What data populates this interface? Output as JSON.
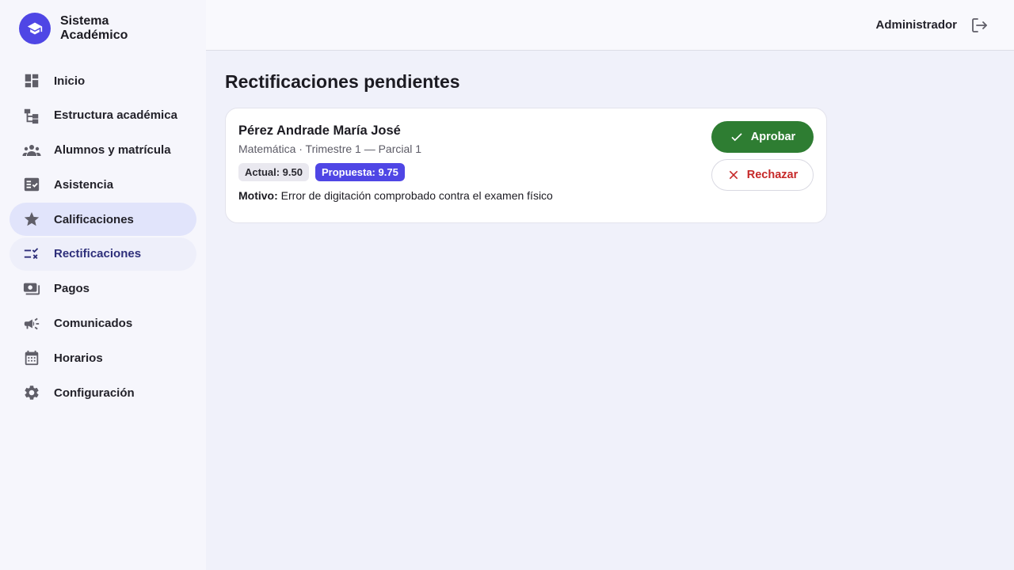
{
  "brand": {
    "title": "Sistema Académico",
    "icon": "graduation-cap-icon",
    "color": "#4f46e5"
  },
  "sidebar": {
    "items": [
      {
        "label": "Inicio",
        "icon": "dashboard-icon",
        "state": "normal"
      },
      {
        "label": "Estructura académica",
        "icon": "hierarchy-icon",
        "state": "normal"
      },
      {
        "label": "Alumnos y matrícula",
        "icon": "group-icon",
        "state": "normal"
      },
      {
        "label": "Asistencia",
        "icon": "checklist-icon",
        "state": "normal"
      },
      {
        "label": "Calificaciones",
        "icon": "star-icon",
        "state": "active"
      },
      {
        "label": "Rectificaciones",
        "icon": "rule-icon",
        "state": "current"
      },
      {
        "label": "Pagos",
        "icon": "payments-icon",
        "state": "normal"
      },
      {
        "label": "Comunicados",
        "icon": "megaphone-icon",
        "state": "normal"
      },
      {
        "label": "Horarios",
        "icon": "calendar-icon",
        "state": "normal"
      },
      {
        "label": "Configuración",
        "icon": "gear-icon",
        "state": "normal"
      }
    ]
  },
  "header": {
    "user": "Administrador",
    "logout_icon": "logout-icon"
  },
  "main": {
    "title": "Rectificaciones pendientes",
    "requests": [
      {
        "student": "Pérez Andrade María José",
        "meta": "Matemática · Trimestre 1 — Parcial 1",
        "current": "Actual: 9.50",
        "proposed": "Propuesta: 9.75",
        "reason_label": "Motivo:",
        "reason": "Error de digitación comprobado contra el examen físico",
        "approve_label": "Aprobar",
        "reject_label": "Rechazar"
      }
    ]
  },
  "colors": {
    "approve": "#2e7d32",
    "reject": "#c62828",
    "accent": "#4f46e5",
    "active_nav": "#e1e4fb"
  }
}
